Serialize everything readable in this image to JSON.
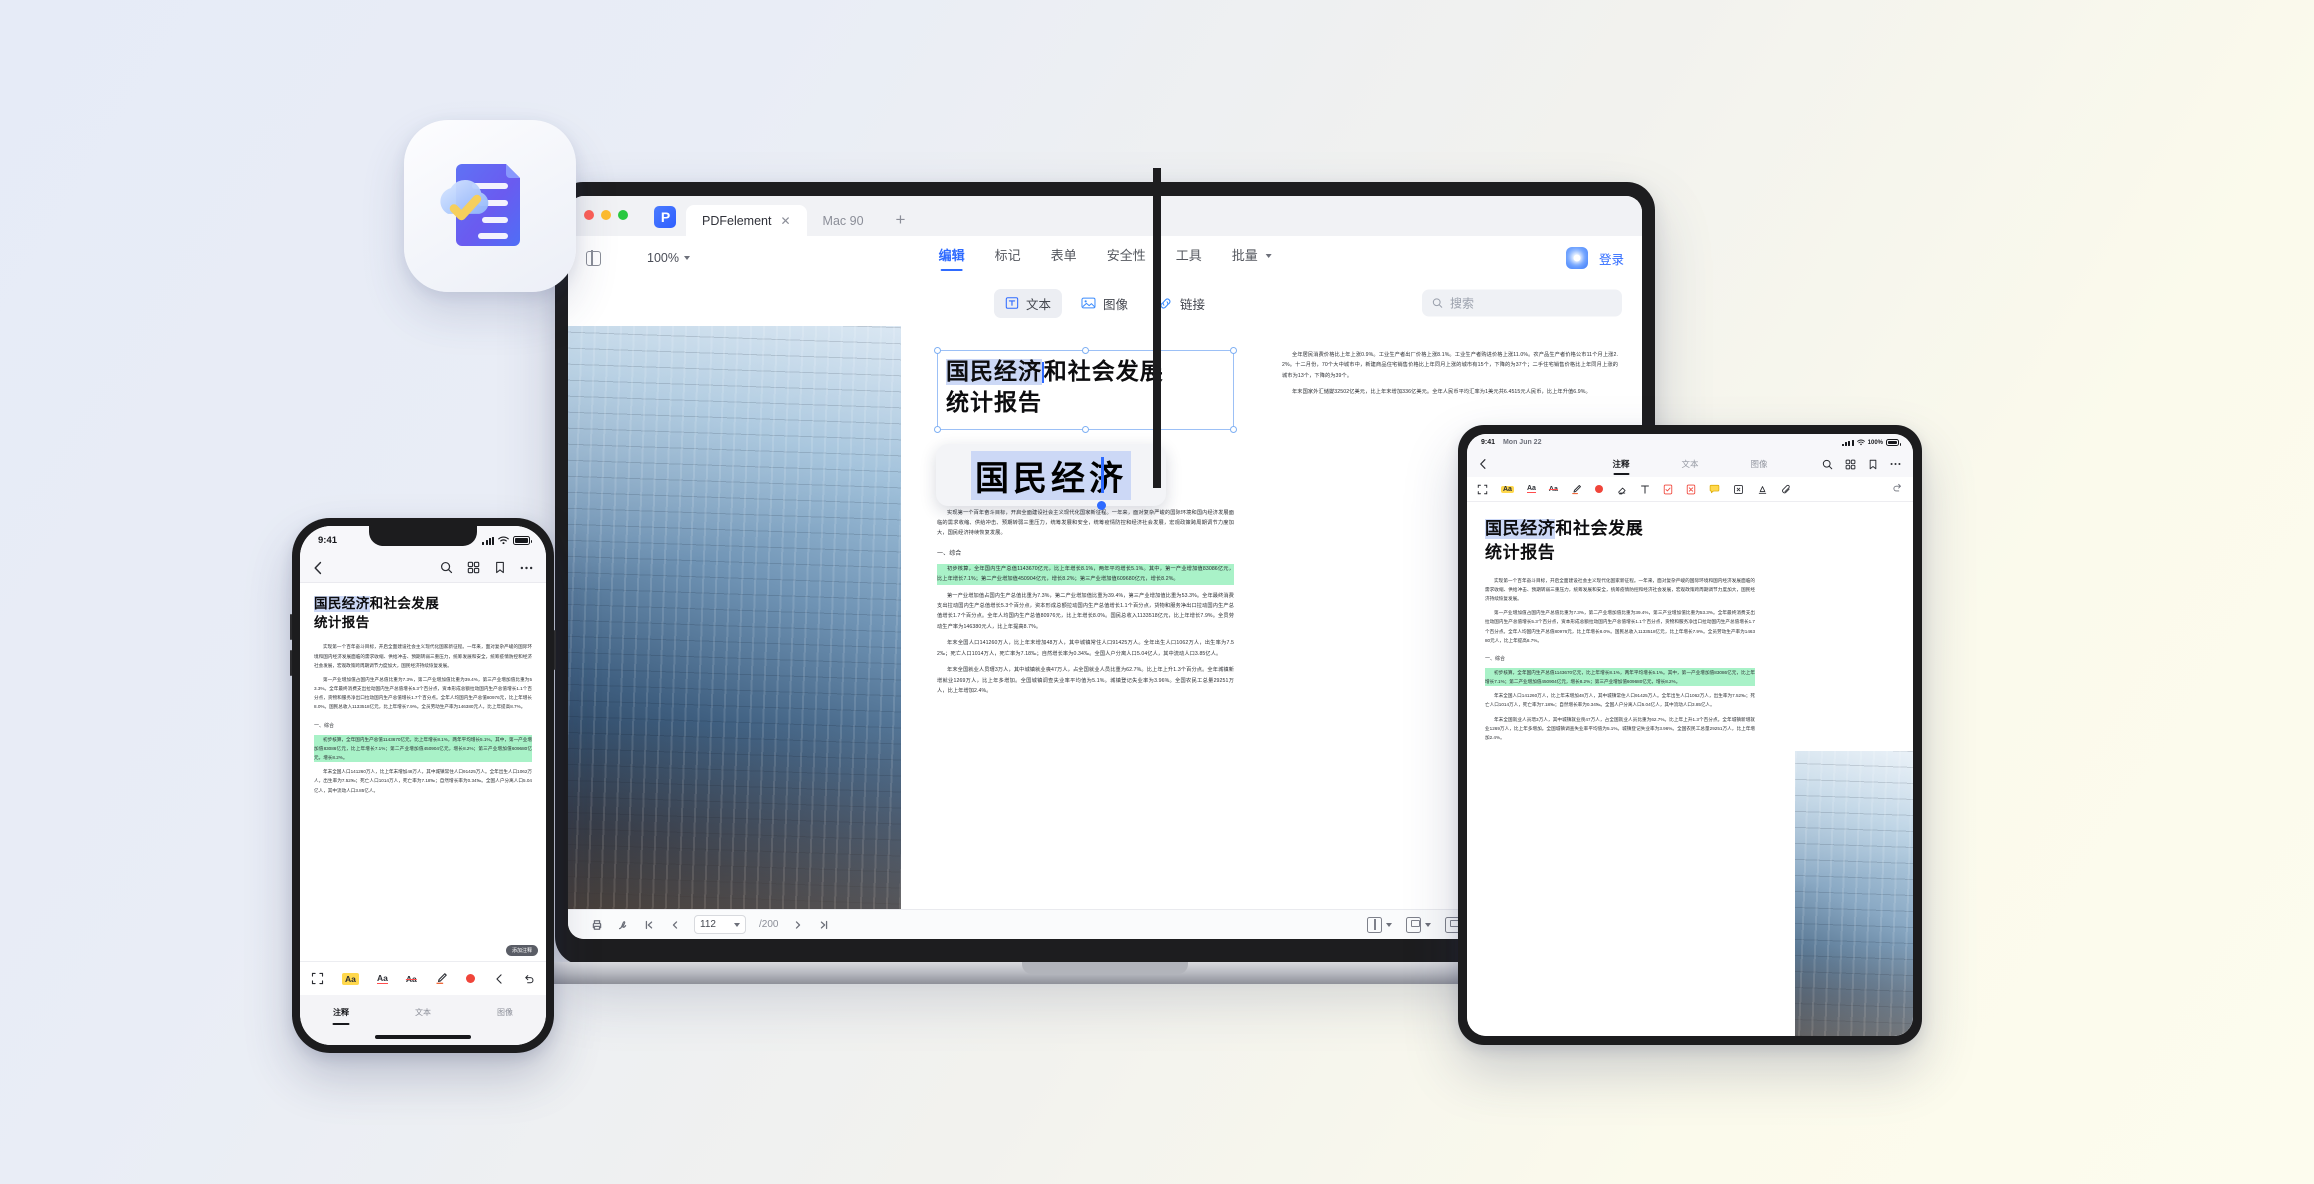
{
  "background": {
    "from": "#E6EBF7",
    "to": "#FDFCEE"
  },
  "brand": {
    "accent": "#2F6BFF",
    "highlight_green": "#A9F2C8",
    "selection_blue": "#CCD8F6"
  },
  "app_icon": {
    "name": "pdfelement-cloud-doc-icon",
    "alt": "Document with cloud check"
  },
  "laptop": {
    "window": {
      "tabs": [
        {
          "label": "PDFelement",
          "active": true,
          "close": "✕"
        },
        {
          "label": "Mac 90",
          "active": false
        }
      ],
      "new_tab": "+",
      "app_badge": "P"
    },
    "toolbar": {
      "zoom_level": "100%",
      "sidebar_toggle": "sidebar-icon",
      "ribbon_tabs": [
        {
          "label": "编辑",
          "active": true
        },
        {
          "label": "标记",
          "active": false
        },
        {
          "label": "表单",
          "active": false
        },
        {
          "label": "安全性",
          "active": false
        },
        {
          "label": "工具",
          "active": false
        },
        {
          "label": "批量",
          "active": false,
          "has_caret": true
        }
      ],
      "login_label": "登录",
      "ai_badge": "ai-icon"
    },
    "subtoolbar": {
      "items": [
        {
          "label": "文本",
          "icon": "text-icon",
          "active": true
        },
        {
          "label": "图像",
          "icon": "image-icon",
          "active": false
        },
        {
          "label": "链接",
          "icon": "link-icon",
          "active": false
        }
      ],
      "search_placeholder": "搜索"
    },
    "document": {
      "title_line1": "国民经济和社会发展",
      "title_line2": "统计报告",
      "title_selected_part": "国民经济",
      "title_rest": "和社会发展",
      "loupe_text": "国民经济",
      "section_heading": "一、综合",
      "intro_paragraph": "实现第一个百年奋斗目标，开启全面建设社会主义现代化国家新征程。一年来，面对复杂严峻的国际环境和国内经济发展面临的需求收缩、供给冲击、预期转弱三重压力，统筹发展和安全，统筹疫情防控和经济社会发展，宏观政策跨周期调节力度加大，国民经济持续恢复发展。",
      "highlight_paragraph": "初步核算，全年国内生产总值1143670亿元，比上年增长8.1%，两年平均增长5.1%。其中，第一产业增加值83086亿元，比上年增长7.1%；第二产业增加值450904亿元，增长8.2%；第三产业增加值609680亿元，增长8.2%。",
      "body_paragraph_2": "第一产业增加值占国内生产总值比重为7.3%，第二产业增加值比重为39.4%，第三产业增加值比重为53.3%。全年最终消费支出拉动国内生产总值增长5.3个百分点，资本形成总额拉动国内生产总值增长1.1个百分点，货物和服务净出口拉动国内生产总值增长1.7个百分点。全年人均国内生产总值80976元，比上年增长8.0%。国民总收入1133518亿元，比上年增长7.9%。全员劳动生产率为146380元人，比上年提高8.7%。",
      "body_paragraph_3": "年末全国人口141260万人，比上年末增加48万人，其中城镇常住人口91425万人。全年出生人口1062万人，出生率为7.52‰；死亡人口1014万人，死亡率为7.18‰；自然增长率为0.34‰。全国人户分离人口5.04亿人，其中流动人口3.85亿人。",
      "body_paragraph_4": "年末全国就业人员瑨3万人，其中城镇就业䘮47万人，占全国就业人员比重为62.7%。比上年上升1.3个百分点。全年城镇新增就业1269万人，比上年多增加。全国城镇调查失业率平均值为5.1%。城镇登记失业率为3.96%。全国农民工总量29251万人，比上年增加2.4%。",
      "right_page_paragraph_1": "全年居民消费价格比上年上涨0.9%。工业生产者出厂价格上涨8.1%。工业生产者购进价格上涨11.0%。农产品生产者价格公市11个月上涨2.2%。十二月份，70个大中城市中，新建商品住宅销售价格比上年同月上涨的城市有15个，下降的为37个；二手住宅销售价格比上年同月上涨的城市为13个，下降的为39个。",
      "right_page_paragraph_2": "年末国家外汇储夑32502亿美元，比上年末增加336亿美元。全年人民币平均汇率为1美元共6.4515元人民币，比上年升值6.9%。",
      "page_current": "112",
      "page_total": "/200",
      "photo_left_alt": "Glass office building at dusk",
      "photo_right_alt": "Modern glass facade"
    }
  },
  "phone": {
    "status": {
      "time": "9:41",
      "signal": "signal-icon",
      "wifi": "wifi-icon",
      "battery": "battery-icon"
    },
    "nav": {
      "back": "back-icon",
      "right_icons": [
        "search-icon",
        "thumbnail-grid-icon",
        "bookmark-icon",
        "more-icon"
      ]
    },
    "document": {
      "title_selected": "国民经济",
      "title_rest": "和社会发展",
      "title_line2": "统计报告",
      "section_heading": "一、综合",
      "tooltip": "添加注释"
    },
    "tools": [
      "select-icon",
      "highlight-icon",
      "underline-icon",
      "strikethrough-icon",
      "brush-icon",
      "color-dot-icon",
      "undo-icon",
      "redo-icon"
    ],
    "tabs": [
      {
        "label": "注释",
        "active": true
      },
      {
        "label": "文本",
        "active": false
      },
      {
        "label": "图像",
        "active": false
      }
    ]
  },
  "tablet": {
    "status": {
      "time": "9:41",
      "date": "Mon Jun 22",
      "wifi": "wifi-icon",
      "battery_pct": "100%",
      "battery": "battery-icon"
    },
    "nav": {
      "back": "back-icon",
      "tabs": [
        {
          "label": "注释",
          "active": true
        },
        {
          "label": "文本",
          "active": false
        },
        {
          "label": "图像",
          "active": false
        }
      ],
      "right_icons": [
        "search-icon",
        "thumbnail-grid-icon",
        "bookmark-icon",
        "more-icon"
      ]
    },
    "tools": [
      "select-icon",
      "highlight-icon",
      "underline-icon",
      "strikethrough-icon",
      "brush-icon",
      "color-dot-icon",
      "eraser-icon",
      "text-icon",
      "stamp-approve-icon",
      "stamp-reject-icon",
      "note-icon",
      "crop-icon",
      "signature-icon",
      "attach-icon",
      "undo-icon"
    ],
    "document": {
      "title_selected": "国民经济",
      "title_rest": "和社会发展",
      "title_line2": "统计报告",
      "section_heading": "一、综合",
      "photo_alt": "Glass building facade"
    }
  }
}
